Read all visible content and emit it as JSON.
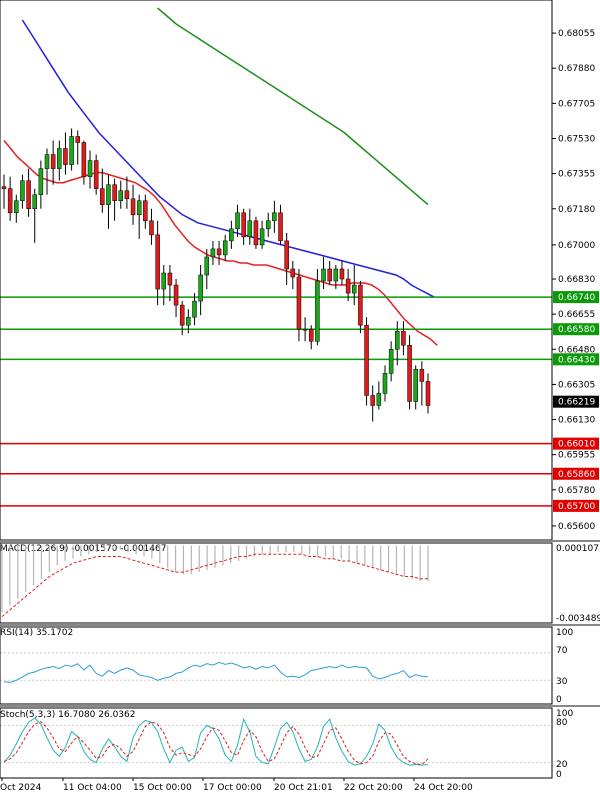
{
  "chart_data": {
    "type": "candlestick",
    "symbol_pair_theme": "price",
    "price_axis": {
      "ylim": [
        0.6553,
        0.6818
      ],
      "ticks": [
        "0.68055",
        "0.67880",
        "0.67705",
        "0.67530",
        "0.67355",
        "0.67180",
        "0.67000",
        "0.66830",
        "0.66655",
        "0.66480",
        "0.66305",
        "0.66130",
        "0.65955",
        "0.65780",
        "0.65600"
      ]
    },
    "x_labels": [
      "Oct 2024",
      "11 Oct 04:00",
      "15 Oct 00:00",
      "17 Oct 00:00",
      "20 Oct 21:01",
      "22 Oct 20:00",
      "24 Oct 20:00"
    ],
    "levels": [
      {
        "price": 0.6674,
        "label": "0.66740",
        "color": "#0a9a0a"
      },
      {
        "price": 0.6658,
        "label": "0.66580",
        "color": "#0a9a0a"
      },
      {
        "price": 0.6643,
        "label": "0.66430",
        "color": "#0a9a0a"
      },
      {
        "price": 0.6601,
        "label": "0.66010",
        "color": "#e00000"
      },
      {
        "price": 0.6586,
        "label": "0.65860",
        "color": "#e00000"
      },
      {
        "price": 0.657,
        "label": "0.65700",
        "color": "#e00000"
      }
    ],
    "current_price": {
      "value": 0.66219,
      "label": "0.66219"
    },
    "candles": [
      [
        0.6729,
        0.6735,
        0.6718,
        0.6728
      ],
      [
        0.6728,
        0.6734,
        0.6712,
        0.6716
      ],
      [
        0.6716,
        0.6725,
        0.6711,
        0.6722
      ],
      [
        0.6722,
        0.6735,
        0.6718,
        0.6732
      ],
      [
        0.6732,
        0.6738,
        0.6714,
        0.6718
      ],
      [
        0.6718,
        0.6728,
        0.6701,
        0.6725
      ],
      [
        0.6725,
        0.6742,
        0.6718,
        0.6738
      ],
      [
        0.6738,
        0.6748,
        0.6725,
        0.6745
      ],
      [
        0.6745,
        0.6752,
        0.673,
        0.6738
      ],
      [
        0.6738,
        0.6752,
        0.6732,
        0.6748
      ],
      [
        0.6748,
        0.6756,
        0.6735,
        0.674
      ],
      [
        0.674,
        0.6758,
        0.6737,
        0.6754
      ],
      [
        0.6754,
        0.6757,
        0.674,
        0.6751
      ],
      [
        0.6751,
        0.6752,
        0.673,
        0.6734
      ],
      [
        0.6734,
        0.6747,
        0.6728,
        0.6742
      ],
      [
        0.6742,
        0.6745,
        0.6725,
        0.6728
      ],
      [
        0.6728,
        0.6738,
        0.6716,
        0.672
      ],
      [
        0.672,
        0.6735,
        0.6708,
        0.673
      ],
      [
        0.673,
        0.6733,
        0.6712,
        0.6722
      ],
      [
        0.6722,
        0.6732,
        0.6718,
        0.6727
      ],
      [
        0.6727,
        0.6734,
        0.6718,
        0.6723
      ],
      [
        0.6723,
        0.673,
        0.671,
        0.6715
      ],
      [
        0.6715,
        0.6725,
        0.6703,
        0.6722
      ],
      [
        0.6722,
        0.6725,
        0.6708,
        0.6712
      ],
      [
        0.6712,
        0.6718,
        0.67,
        0.6705
      ],
      [
        0.6705,
        0.6712,
        0.667,
        0.6678
      ],
      [
        0.6678,
        0.669,
        0.667,
        0.6686
      ],
      [
        0.6686,
        0.669,
        0.6672,
        0.668
      ],
      [
        0.668,
        0.6683,
        0.6664,
        0.667
      ],
      [
        0.667,
        0.6672,
        0.6655,
        0.666
      ],
      [
        0.666,
        0.6668,
        0.6656,
        0.6664
      ],
      [
        0.6664,
        0.6676,
        0.666,
        0.6672
      ],
      [
        0.6672,
        0.669,
        0.6665,
        0.6685
      ],
      [
        0.6685,
        0.6698,
        0.6678,
        0.6694
      ],
      [
        0.6694,
        0.6702,
        0.669,
        0.6698
      ],
      [
        0.6698,
        0.6702,
        0.669,
        0.6695
      ],
      [
        0.6695,
        0.6705,
        0.6692,
        0.6702
      ],
      [
        0.6702,
        0.6712,
        0.6698,
        0.6708
      ],
      [
        0.6708,
        0.672,
        0.6704,
        0.6716
      ],
      [
        0.6716,
        0.6718,
        0.67,
        0.6704
      ],
      [
        0.6704,
        0.6718,
        0.67,
        0.6712
      ],
      [
        0.6712,
        0.6714,
        0.6698,
        0.67
      ],
      [
        0.67,
        0.6712,
        0.6698,
        0.6708
      ],
      [
        0.6708,
        0.6716,
        0.6704,
        0.6712
      ],
      [
        0.6712,
        0.6722,
        0.6706,
        0.6716
      ],
      [
        0.6716,
        0.672,
        0.67,
        0.6702
      ],
      [
        0.6702,
        0.6706,
        0.668,
        0.6688
      ],
      [
        0.6688,
        0.6692,
        0.6678,
        0.6684
      ],
      [
        0.6684,
        0.6688,
        0.6652,
        0.6658
      ],
      [
        0.6658,
        0.6664,
        0.6652,
        0.6658
      ],
      [
        0.6658,
        0.666,
        0.6648,
        0.6652
      ],
      [
        0.6652,
        0.6688,
        0.665,
        0.6682
      ],
      [
        0.6682,
        0.6694,
        0.6678,
        0.6688
      ],
      [
        0.6688,
        0.6692,
        0.668,
        0.6682
      ],
      [
        0.6682,
        0.669,
        0.6678,
        0.6688
      ],
      [
        0.6688,
        0.6692,
        0.668,
        0.6683
      ],
      [
        0.6683,
        0.6688,
        0.6672,
        0.6676
      ],
      [
        0.6676,
        0.669,
        0.667,
        0.668
      ],
      [
        0.668,
        0.6682,
        0.6656,
        0.666
      ],
      [
        0.666,
        0.6664,
        0.662,
        0.6625
      ],
      [
        0.6625,
        0.663,
        0.6612,
        0.662
      ],
      [
        0.662,
        0.6632,
        0.6618,
        0.6626
      ],
      [
        0.6626,
        0.664,
        0.6622,
        0.6636
      ],
      [
        0.6636,
        0.6652,
        0.6632,
        0.6648
      ],
      [
        0.6648,
        0.6662,
        0.664,
        0.6657
      ],
      [
        0.6657,
        0.6662,
        0.6645,
        0.665
      ],
      [
        0.665,
        0.6655,
        0.6618,
        0.6622
      ],
      [
        0.6622,
        0.664,
        0.6618,
        0.6638
      ],
      [
        0.6638,
        0.6642,
        0.662,
        0.6632
      ],
      [
        0.6632,
        0.6636,
        0.6616,
        0.662
      ]
    ],
    "ma_fast": [
      0.6752,
      0.6748,
      0.6744,
      0.6741,
      0.6738,
      0.6735,
      0.6733,
      0.6732,
      0.6731,
      0.6731,
      0.6732,
      0.6733,
      0.6734,
      0.6735,
      0.6736,
      0.6736,
      0.6735,
      0.6734,
      0.6733,
      0.6732,
      0.6731,
      0.6729,
      0.6727,
      0.6724,
      0.672,
      0.6715,
      0.671,
      0.6706,
      0.6702,
      0.6699,
      0.6697,
      0.6695,
      0.6694,
      0.6693,
      0.6692,
      0.6692,
      0.6691,
      0.6691,
      0.669,
      0.669,
      0.669,
      0.6689,
      0.6688,
      0.6687,
      0.6686,
      0.6685,
      0.6684,
      0.6683,
      0.6682,
      0.6681,
      0.668,
      0.668,
      0.668,
      0.6681,
      0.6681,
      0.6681,
      0.668,
      0.6678,
      0.6675,
      0.6671,
      0.6667,
      0.6663,
      0.666,
      0.6657,
      0.6655,
      0.6653,
      0.665
    ],
    "ma_mid": [
      0.6812,
      0.6806,
      0.68,
      0.6794,
      0.6788,
      0.6782,
      0.6776,
      0.6771,
      0.6766,
      0.6761,
      0.6756,
      0.6752,
      0.6748,
      0.6744,
      0.674,
      0.6736,
      0.6732,
      0.6728,
      0.6724,
      0.6721,
      0.6718,
      0.6715,
      0.6713,
      0.6711,
      0.671,
      0.6709,
      0.6708,
      0.6707,
      0.6706,
      0.6705,
      0.6704,
      0.6703,
      0.6702,
      0.6701,
      0.67,
      0.6699,
      0.6698,
      0.6697,
      0.6696,
      0.6695,
      0.6694,
      0.6693,
      0.6692,
      0.6691,
      0.669,
      0.6689,
      0.6688,
      0.6687,
      0.6686,
      0.6685,
      0.6683,
      0.668,
      0.6678,
      0.6676,
      0.6674
    ],
    "ma_slow": [
      0.6818,
      0.6814,
      0.681,
      0.6807,
      0.6804,
      0.6801,
      0.6798,
      0.6795,
      0.6792,
      0.6789,
      0.6786,
      0.6783,
      0.678,
      0.6777,
      0.6774,
      0.6771,
      0.6768,
      0.6765,
      0.6762,
      0.6759,
      0.6756,
      0.6752,
      0.6748,
      0.6744,
      0.674,
      0.6736,
      0.6732,
      0.6728,
      0.6724,
      0.672
    ],
    "macd": {
      "title": "MACD(12,26,9) -0.001570 -0.001467",
      "scale_top": "0.000107",
      "scale_bottom": "-0.003489",
      "ylim": [
        -0.003489,
        0.000107
      ],
      "hist": [
        -0.003,
        -0.0027,
        -0.0024,
        -0.0021,
        -0.0018,
        -0.0015,
        -0.0012,
        -0.0009,
        -0.0007,
        -0.0006,
        -0.0005,
        -0.0004,
        -0.0003,
        -0.0002,
        -0.0002,
        -0.0002,
        -0.0003,
        -0.0004,
        -0.0005,
        -0.0006,
        -0.0008,
        -0.001,
        -0.0012,
        -0.0013,
        -0.0013,
        -0.0012,
        -0.0011,
        -0.001,
        -0.0009,
        -0.0008,
        -0.0007,
        -0.0006,
        -0.0005,
        -0.0004,
        -0.0004,
        -0.0003,
        -0.0003,
        -0.0003,
        -0.0004,
        -0.0004,
        -0.0005,
        -0.0005,
        -0.0006,
        -0.0006,
        -0.0007,
        -0.0008,
        -0.0009,
        -0.001,
        -0.0011,
        -0.0012,
        -0.0013,
        -0.0014,
        -0.0015,
        -0.0016,
        -0.0016
      ],
      "signal": [
        -0.0032,
        -0.0029,
        -0.0026,
        -0.0023,
        -0.002,
        -0.0017,
        -0.0014,
        -0.0012,
        -0.001,
        -0.0008,
        -0.0007,
        -0.0006,
        -0.0005,
        -0.0005,
        -0.0005,
        -0.0005,
        -0.0006,
        -0.0007,
        -0.0008,
        -0.0009,
        -0.001,
        -0.0011,
        -0.0012,
        -0.0012,
        -0.0011,
        -0.001,
        -0.0009,
        -0.0008,
        -0.0007,
        -0.0006,
        -0.0005,
        -0.0005,
        -0.0004,
        -0.0004,
        -0.0004,
        -0.0004,
        -0.0004,
        -0.0004,
        -0.0004,
        -0.0005,
        -0.0005,
        -0.0006,
        -0.0006,
        -0.0007,
        -0.0007,
        -0.0008,
        -0.0009,
        -0.001,
        -0.0011,
        -0.0012,
        -0.0013,
        -0.0014,
        -0.0014,
        -0.0015,
        -0.0015
      ]
    },
    "rsi": {
      "title": "RSI(14) 35.1702",
      "levels": [
        "100",
        "70",
        "30",
        "0"
      ],
      "values": [
        28,
        27,
        30,
        35,
        40,
        42,
        46,
        48,
        50,
        47,
        52,
        50,
        54,
        45,
        52,
        40,
        36,
        44,
        40,
        45,
        48,
        45,
        38,
        36,
        34,
        30,
        33,
        35,
        40,
        42,
        48,
        52,
        50,
        54,
        52,
        56,
        53,
        55,
        52,
        48,
        50,
        46,
        50,
        48,
        52,
        42,
        35,
        36,
        34,
        38,
        44,
        46,
        48,
        50,
        48,
        52,
        48,
        50,
        49,
        48,
        36,
        32,
        34,
        38,
        40,
        44,
        34,
        38,
        36,
        35
      ]
    },
    "stoch": {
      "title": "Stoch(5,3,3) 16.7080 26.0362",
      "levels": [
        "100",
        "80",
        "20",
        "0"
      ],
      "k": [
        20,
        32,
        50,
        70,
        85,
        92,
        82,
        60,
        40,
        30,
        45,
        70,
        62,
        38,
        25,
        20,
        42,
        58,
        46,
        30,
        22,
        60,
        80,
        88,
        85,
        70,
        42,
        20,
        40,
        45,
        22,
        28,
        68,
        80,
        75,
        58,
        32,
        22,
        48,
        90,
        70,
        30,
        20,
        18,
        45,
        75,
        85,
        70,
        42,
        22,
        25,
        45,
        78,
        90,
        60,
        38,
        22,
        16,
        18,
        30,
        50,
        82,
        72,
        45,
        28,
        20,
        16,
        17,
        16,
        17
      ],
      "d": [
        22,
        26,
        36,
        52,
        70,
        82,
        86,
        76,
        60,
        42,
        38,
        52,
        62,
        52,
        40,
        27,
        30,
        45,
        50,
        42,
        30,
        38,
        58,
        78,
        86,
        82,
        68,
        44,
        32,
        36,
        33,
        30,
        42,
        62,
        76,
        72,
        55,
        36,
        32,
        56,
        72,
        62,
        38,
        22,
        26,
        46,
        68,
        78,
        66,
        44,
        28,
        30,
        50,
        72,
        76,
        58,
        38,
        24,
        18,
        20,
        30,
        54,
        68,
        66,
        48,
        30,
        22,
        18,
        17,
        26
      ]
    }
  }
}
